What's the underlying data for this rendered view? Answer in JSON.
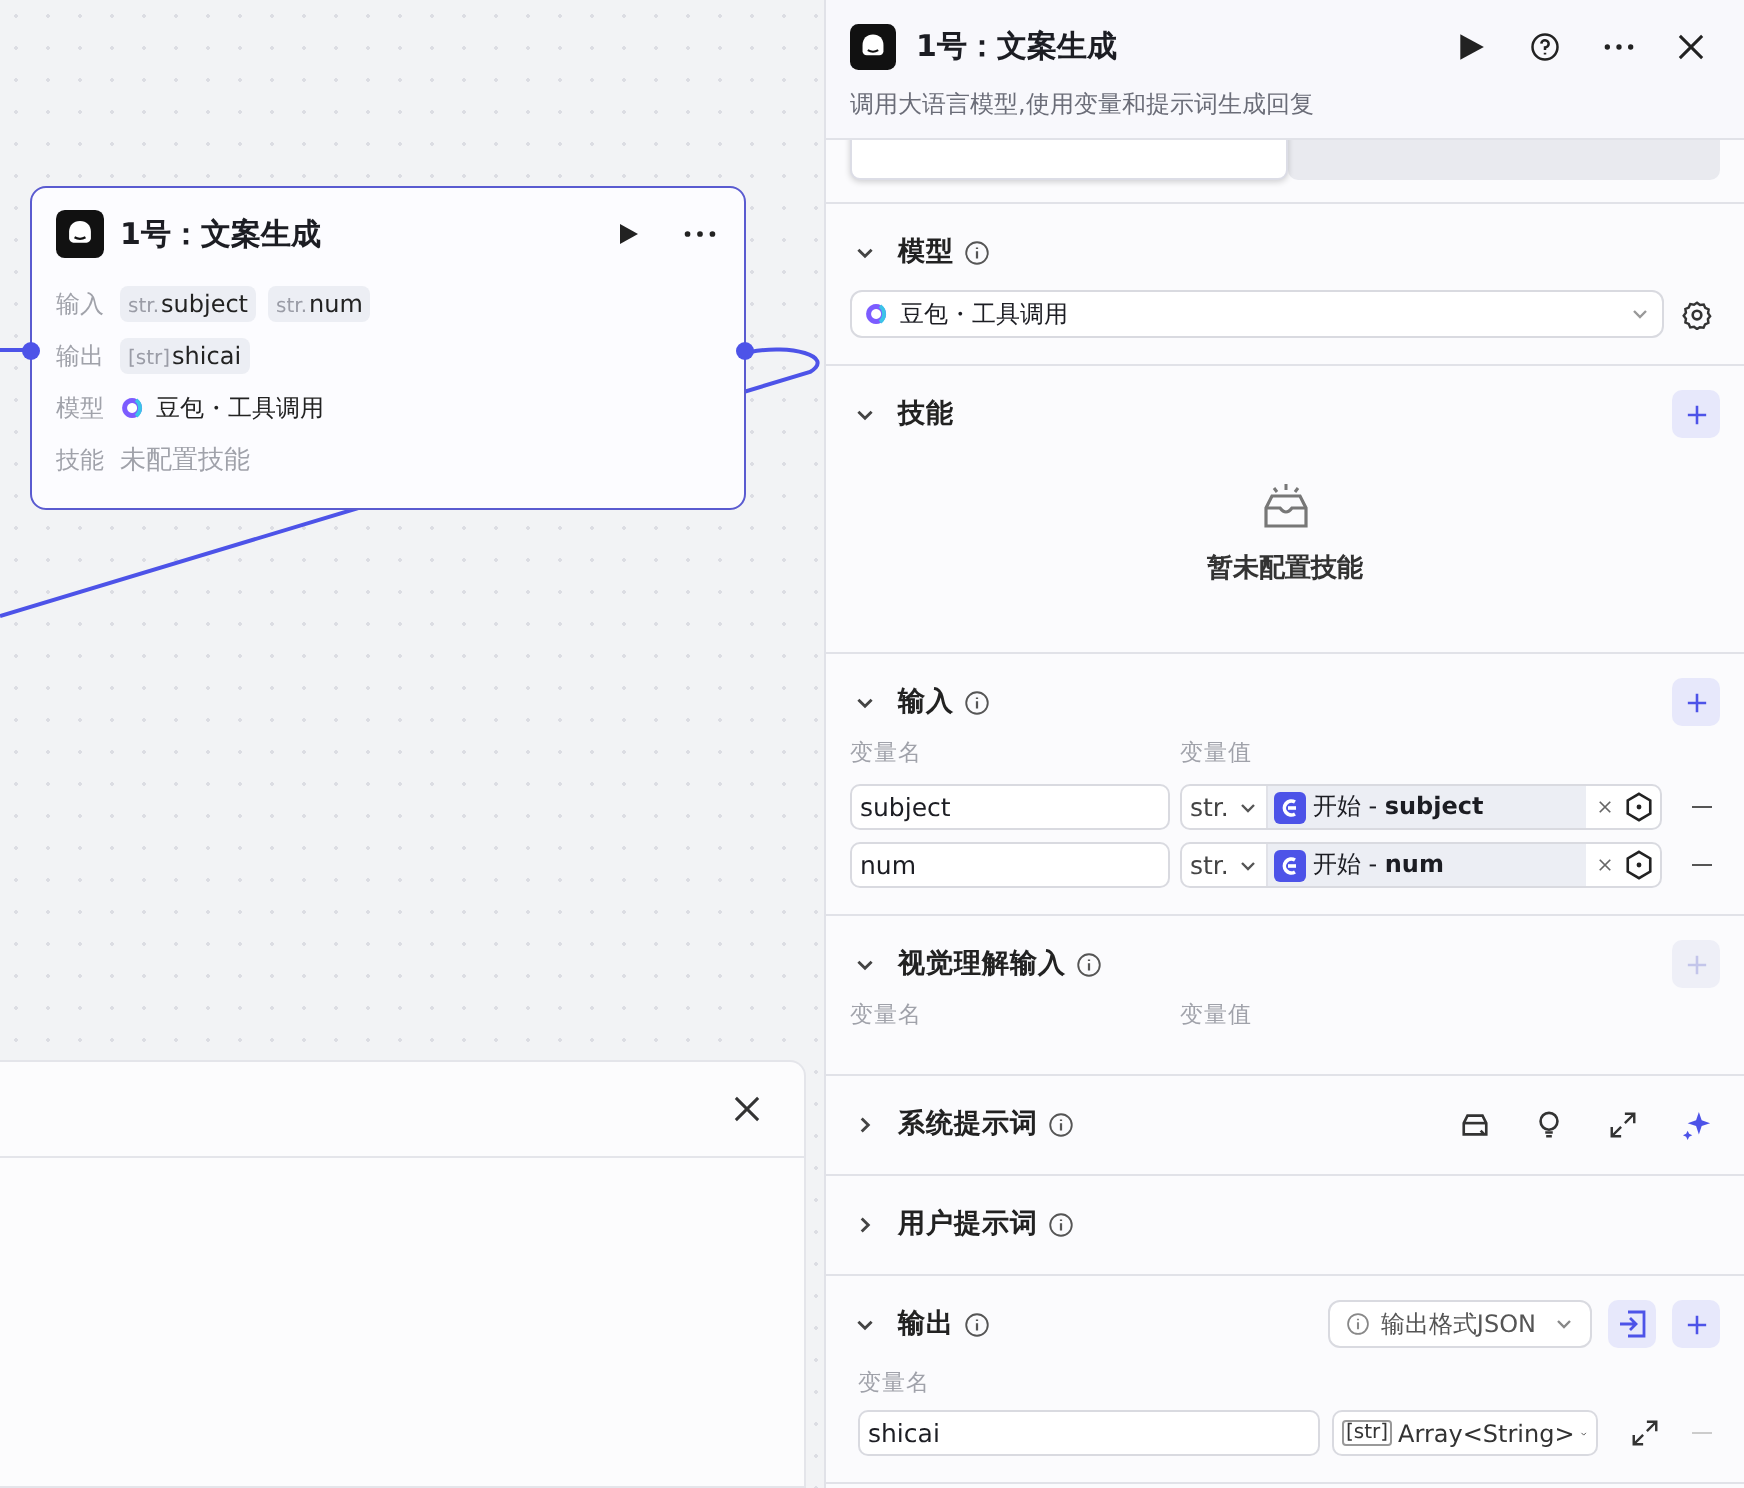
{
  "canvas": {
    "node": {
      "title": "1号：文案生成",
      "rows": [
        {
          "label": "输入",
          "kind": "tags",
          "tags": [
            {
              "type": "str.",
              "name": "subject"
            },
            {
              "type": "str.",
              "name": "num"
            }
          ]
        },
        {
          "label": "输出",
          "kind": "tags",
          "tags": [
            {
              "type": "[str]",
              "name": "shicai"
            }
          ]
        },
        {
          "label": "模型",
          "kind": "model",
          "value": "豆包・工具调用"
        },
        {
          "label": "技能",
          "kind": "empty",
          "value": "未配置技能"
        }
      ]
    }
  },
  "panel": {
    "title": "1号：文案生成",
    "subtitle": "调用大语言模型,使用变量和提示词生成回复",
    "tabs": [
      {
        "selected": true
      },
      {
        "selected": false
      }
    ],
    "sections": [
      {
        "kind": "model",
        "title": "模型",
        "info": true,
        "expanded": true,
        "value": "豆包・工具调用"
      },
      {
        "kind": "skills",
        "title": "技能",
        "info": false,
        "expanded": true,
        "empty_text": "暂未配置技能"
      },
      {
        "kind": "inputs",
        "title": "输入",
        "info": true,
        "expanded": true,
        "add_disabled": false,
        "columns": [
          "变量名",
          "变量值"
        ],
        "rows": [
          {
            "name": "subject",
            "type": "str.",
            "reference": "开始 - **subject**"
          },
          {
            "name": "num",
            "type": "str.",
            "reference": "开始 - **num**"
          }
        ]
      },
      {
        "kind": "inputs",
        "title": "视觉理解输入",
        "info": true,
        "expanded": true,
        "add_disabled": true,
        "columns": [
          "变量名",
          "变量值"
        ]
      },
      {
        "kind": "prompt",
        "title": "系统提示词",
        "info": true,
        "expanded": false,
        "tools": true
      },
      {
        "kind": "prompt",
        "title": "用户提示词",
        "info": true,
        "expanded": false,
        "tools": false
      },
      {
        "kind": "output",
        "title": "输出",
        "info": true,
        "expanded": true,
        "format": "输出格式JSON",
        "columns": [
          "变量名"
        ],
        "rows": [
          {
            "name": "shicai",
            "type": "[str]",
            "type_name": "Array<String>"
          }
        ]
      }
    ]
  }
}
